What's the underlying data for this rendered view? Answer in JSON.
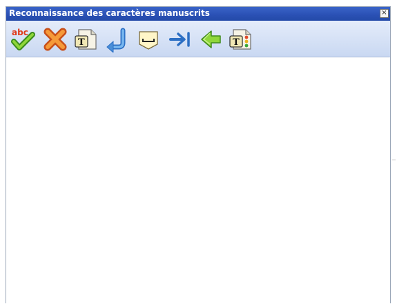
{
  "window": {
    "title": "Reconnaissance des caractères manuscrits",
    "close_glyph": "×"
  },
  "toolbar": {
    "buttons": [
      {
        "icon": "spellcheck-abc-icon",
        "label": "abc"
      },
      {
        "icon": "delete-x-icon"
      },
      {
        "icon": "insert-text-icon",
        "label": "T"
      },
      {
        "icon": "enter-return-icon"
      },
      {
        "icon": "space-icon"
      },
      {
        "icon": "tab-icon"
      },
      {
        "icon": "backspace-arrow-icon"
      },
      {
        "icon": "text-options-icon",
        "label": "T"
      }
    ]
  },
  "colors": {
    "titlebar": "#2a50b4",
    "toolbar": "#c9d8f2"
  }
}
